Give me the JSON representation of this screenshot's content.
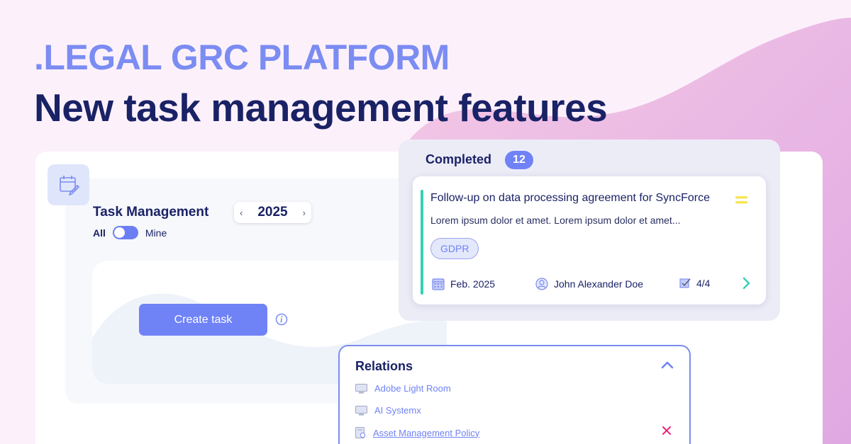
{
  "eyebrow": ".LEGAL GRC PLATFORM",
  "headline": "New task management features",
  "task_management": {
    "title": "Task Management",
    "year": "2025",
    "filter_all": "All",
    "filter_mine": "Mine",
    "create_button": "Create task"
  },
  "completed": {
    "title": "Completed",
    "count": "12",
    "card": {
      "title": "Follow-up on data processing agreement for SyncForce",
      "description": "Lorem ipsum dolor et amet. Lorem ipsum dolor et amet...",
      "tag": "GDPR",
      "date": "Feb. 2025",
      "assignee": "John Alexander Doe",
      "checklist": "4/4"
    }
  },
  "relations": {
    "title": "Relations",
    "items": [
      {
        "label": "Adobe Light Room",
        "icon": "monitor-icon"
      },
      {
        "label": "AI Systemx",
        "icon": "monitor-icon"
      },
      {
        "label": "Asset Management Policy",
        "icon": "policy-document-icon"
      }
    ]
  },
  "colors": {
    "accent": "#6f82f6",
    "navy": "#1a2266",
    "teal": "#36d0b4",
    "priority_yellow": "#f7e55c",
    "remove_pink": "#e8267a"
  }
}
